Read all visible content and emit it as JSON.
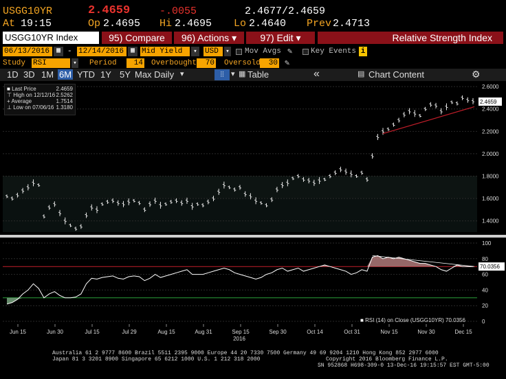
{
  "header": {
    "ticker": "USGG10YR",
    "last": "2.4659",
    "change": "-.0055",
    "bid_ask": "2.4677/2.4659",
    "at_label": "At",
    "time": "19:15",
    "op_label": "Op",
    "op": "2.4695",
    "hi_label": "Hi",
    "hi": "2.4695",
    "lo_label": "Lo",
    "lo": "2.4640",
    "prev_label": "Prev",
    "prev": "2.4713"
  },
  "toolbar": {
    "index_label": "USGG10YR Index",
    "compare": "95) Compare",
    "actions": "96) Actions",
    "edit": "97) Edit",
    "study_title": "Relative Strength Index"
  },
  "controls": {
    "start_date": "06/13/2016",
    "end_date": "12/14/2016",
    "field": "Mid Yield",
    "currency": "USD",
    "mov_avgs": "Mov Avgs",
    "key_events": "Key Events",
    "info": "i",
    "study_label": "Study",
    "study": "RSI",
    "period_label": "Period",
    "period": "14",
    "overbought_label": "Overbought",
    "overbought": "70",
    "oversold_label": "Oversold",
    "oversold": "30"
  },
  "ranges": {
    "items": [
      "1D",
      "3D",
      "1M",
      "6M",
      "YTD",
      "1Y",
      "5Y"
    ],
    "active": "6M",
    "freq": "Max Daily",
    "table": "Table",
    "collapse": "«",
    "chart_content": "Chart Content",
    "settings": "⚙"
  },
  "legend": {
    "last_price_label": "Last Price",
    "last_price": "2.4659",
    "high_label": "High on 12/12/16",
    "high": "2.5262",
    "average_label": "Average",
    "average": "1.7514",
    "low_label": "Low on 07/06/16",
    "low": "1.3180"
  },
  "rsi_legend": "RSI (14) on Close (USGG10YR) 70.0356",
  "colors": {
    "amber": "#f5a623",
    "red_button": "#8b1119",
    "orange_field": "#f7a400",
    "background": "#000000",
    "rsi_line": "#ffffff",
    "threshold_red": "#c41e2a",
    "threshold_green": "#2aa13a"
  },
  "chart_data": [
    {
      "type": "line",
      "series": [
        {
          "name": "Last Price",
          "values": [
            1.62,
            1.6,
            1.63,
            1.67,
            1.7,
            1.74,
            1.72,
            1.44,
            1.52,
            1.55,
            1.47,
            1.4,
            1.36,
            1.33,
            1.35,
            1.45,
            1.52,
            1.5,
            1.55,
            1.57,
            1.58,
            1.56,
            1.55,
            1.57,
            1.58,
            1.56,
            1.5,
            1.55,
            1.58,
            1.54,
            1.55,
            1.57,
            1.58,
            1.56,
            1.58,
            1.53,
            1.55,
            1.54,
            1.57,
            1.6,
            1.66,
            1.72,
            1.7,
            1.68,
            1.7,
            1.64,
            1.62,
            1.58,
            1.56,
            1.54,
            1.59,
            1.68,
            1.72,
            1.74,
            1.78,
            1.8,
            1.77,
            1.76,
            1.74,
            1.76,
            1.77,
            1.8,
            1.83,
            1.86,
            1.84,
            1.82,
            1.8,
            1.83,
            1.77,
            1.98,
            2.15,
            2.2,
            2.22,
            2.26,
            2.3,
            2.35,
            2.38,
            2.36,
            2.34,
            2.4,
            2.44,
            2.43,
            2.38,
            2.42,
            2.46,
            2.45,
            2.5,
            2.48,
            2.47
          ]
        }
      ],
      "y_ticks": [
        "2.6000",
        "2.4000",
        "2.2000",
        "2.0000",
        "1.8000",
        "1.6000",
        "1.4000"
      ],
      "x_ticks": [
        "Jun 15",
        "Jun 30",
        "Jul 15",
        "Jul 29",
        "Aug 15",
        "Aug 31",
        "Sep 15",
        "Sep 30",
        "Oct 14",
        "Oct 31",
        "Nov 15",
        "Nov 30",
        "Dec 15"
      ],
      "x_year": "2016",
      "ylim": [
        1.3,
        2.65
      ],
      "last_value_label": "2.4659",
      "grid": true
    },
    {
      "type": "line",
      "series": [
        {
          "name": "RSI (14) on Close (USGG10YR)",
          "values": [
            22,
            24,
            28,
            35,
            40,
            48,
            42,
            30,
            35,
            38,
            33,
            30,
            30,
            31,
            35,
            48,
            55,
            54,
            56,
            57,
            58,
            55,
            54,
            57,
            58,
            57,
            52,
            55,
            60,
            56,
            58,
            60,
            62,
            64,
            66,
            60,
            60,
            60,
            62,
            64,
            66,
            68,
            66,
            62,
            60,
            58,
            56,
            54,
            56,
            60,
            62,
            66,
            68,
            64,
            66,
            68,
            64,
            66,
            68,
            70,
            72,
            70,
            68,
            66,
            64,
            60,
            62,
            66,
            64,
            82,
            84,
            80,
            82,
            80,
            82,
            80,
            78,
            76,
            74,
            74,
            72,
            70,
            66,
            64,
            68,
            72,
            70,
            70,
            70
          ]
        }
      ],
      "y_ticks": [
        "100",
        "80",
        "60",
        "40",
        "20",
        "0"
      ],
      "ylim": [
        0,
        100
      ],
      "overbought": 70,
      "oversold": 30,
      "last_value_label": "70.0356"
    }
  ],
  "footer": {
    "line1": "Australia 61 2 9777 8600 Brazil 5511 2395 9000 Europe 44 20 7330 7500 Germany 49 69 9204 1210 Hong Kong 852 2977 6000",
    "line2_left": "Japan 81 3 3201 8900          Singapore 65 6212 1000          U.S. 1 212 318 2000",
    "line2_right": "Copyright 2016 Bloomberg Finance L.P.",
    "line3": "SN 952868 H698-309-0 13-Dec-16 19:15:57 EST  GMT-5:00"
  }
}
